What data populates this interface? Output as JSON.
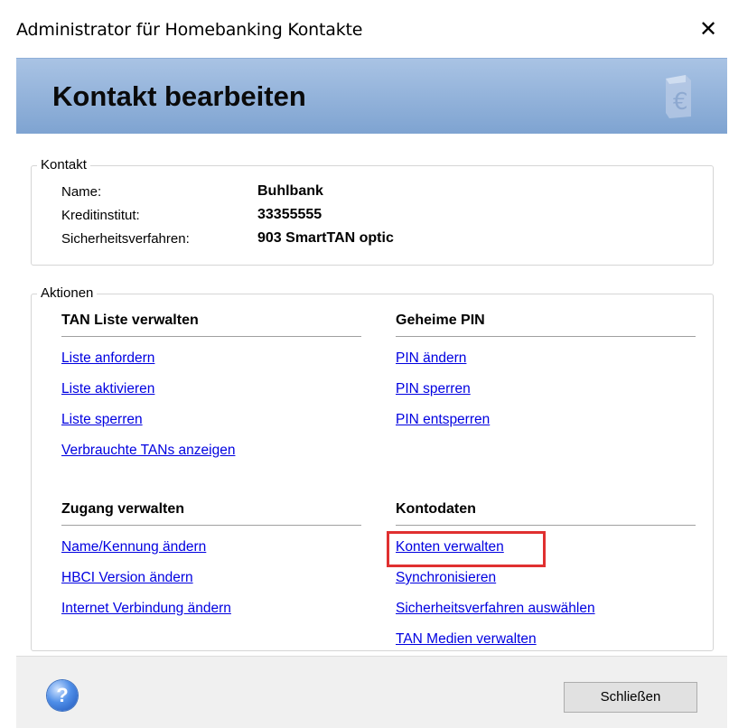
{
  "window": {
    "title": "Administrator für Homebanking Kontakte",
    "close_glyph": "✕"
  },
  "header": {
    "heading": "Kontakt bearbeiten",
    "logo_icon": "euro-card-icon"
  },
  "contact": {
    "legend": "Kontakt",
    "name_label": "Name:",
    "name_value": "Buhlbank",
    "bank_label": "Kreditinstitut:",
    "bank_value": "33355555",
    "security_label": "Sicherheitsverfahren:",
    "security_value": "903 SmartTAN optic"
  },
  "actions": {
    "legend": "Aktionen",
    "tan": {
      "heading": "TAN Liste verwalten",
      "links": [
        "Liste anfordern",
        "Liste aktivieren",
        "Liste sperren",
        "Verbrauchte TANs anzeigen"
      ]
    },
    "pin": {
      "heading": "Geheime PIN",
      "links": [
        "PIN ändern",
        "PIN sperren",
        "PIN entsperren"
      ]
    },
    "access": {
      "heading": "Zugang verwalten",
      "links": [
        "Name/Kennung ändern",
        "HBCI Version ändern",
        "Internet Verbindung ändern"
      ]
    },
    "account": {
      "heading": "Kontodaten",
      "links": [
        "Konten verwalten",
        "Synchronisieren",
        "Sicherheitsverfahren auswählen",
        "TAN Medien verwalten"
      ]
    }
  },
  "footer": {
    "help_glyph": "?",
    "close_button": "Schließen"
  },
  "colors": {
    "link": "#0000e0",
    "highlight": "#e03030",
    "header_top": "#a9c3e4",
    "header_bottom": "#7ea3d1"
  }
}
